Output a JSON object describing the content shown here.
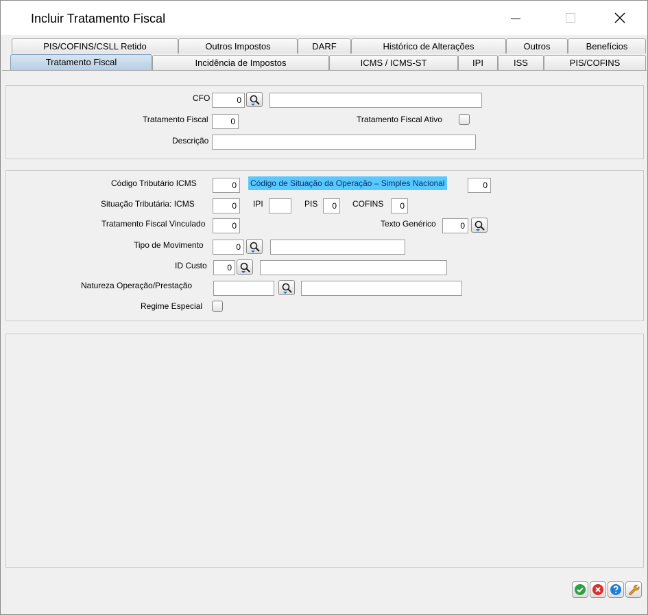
{
  "window": {
    "title": "Incluir Tratamento Fiscal"
  },
  "tabs": {
    "row1": [
      "PIS/COFINS/CSLL Retido",
      "Outros Impostos",
      "DARF",
      "Histórico de Alterações",
      "Outros",
      "Benefícios"
    ],
    "row2": [
      "Tratamento Fiscal",
      "Incidência de Impostos",
      "ICMS / ICMS-ST",
      "IPI",
      "ISS",
      "PIS/COFINS"
    ],
    "active": "Tratamento Fiscal"
  },
  "section1": {
    "cfo_label": "CFO",
    "cfo_value": "0",
    "cfo_desc_value": "",
    "tratamento_fiscal_label": "Tratamento Fiscal",
    "tratamento_fiscal_value": "0",
    "tratamento_fiscal_ativo_label": "Tratamento Fiscal Ativo",
    "descricao_label": "Descrição",
    "descricao_value": ""
  },
  "section2": {
    "codigo_tributario_icms_label": "Código Tributário ICMS",
    "codigo_tributario_icms_value": "0",
    "csosn_label": "Código de Situação da Operação – Simples Nacional",
    "csosn_value": "0",
    "situacao_tributaria_icms_label": "Situação Tributária: ICMS",
    "situacao_tributaria_icms_value": "0",
    "ipi_label": "IPI",
    "ipi_value": "",
    "pis_label": "PIS",
    "pis_value": "0",
    "cofins_label": "COFINS",
    "cofins_value": "0",
    "tratamento_fiscal_vinculado_label": "Tratamento Fiscal Vinculado",
    "tratamento_fiscal_vinculado_value": "0",
    "texto_generico_label": "Texto Genérico",
    "texto_generico_value": "0",
    "tipo_movimento_label": "Tipo de Movimento",
    "tipo_movimento_value": "0",
    "tipo_movimento_desc": "",
    "id_custo_label": "ID Custo",
    "id_custo_value": "0",
    "id_custo_desc": "",
    "natureza_operacao_label": "Natureza Operação/Prestação",
    "natureza_operacao_value": "",
    "natureza_operacao_desc": "",
    "regime_especial_label": "Regime Especial"
  },
  "actions": {
    "colors": {
      "confirm": "#2ea043",
      "cancel": "#d9302c",
      "help": "#1f7fd6",
      "tools": "#e89a2c"
    }
  }
}
